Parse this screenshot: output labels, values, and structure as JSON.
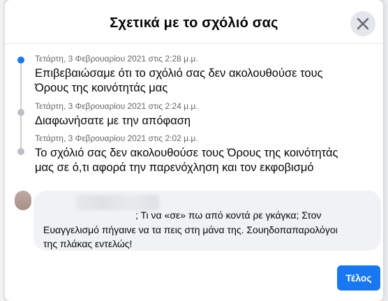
{
  "dialog": {
    "title": "Σχετικά με το σχόλιό σας",
    "close_icon": "close-icon",
    "done_label": "Τέλος",
    "accent_color": "#1877f2"
  },
  "timeline": [
    {
      "date": "Τετάρτη, 3 Φεβρουαρίου 2021 στις 2:28 μ.μ.",
      "lines": [
        "Επιβεβαιώσαμε ότι το σχόλιό σας δεν ακολουθούσε τους",
        "Όρους της κοινότητάς μας"
      ],
      "active": true
    },
    {
      "date": "Τετάρτη, 3 Φεβρουαρίου 2021 στις 2:24 μ.μ.",
      "lines": [
        "Διαφωνήσατε με την απόφαση"
      ],
      "active": false
    },
    {
      "date": "Τετάρτη, 3 Φεβρουαρίου 2021 στις 2:02 μ.μ.",
      "lines": [
        "Το σχόλιό σας δεν ακολουθούσε τους Όρους της κοινότητάς",
        "μας σε ό,τι αφορά την παρενόχληση και τον εκφοβισμό"
      ],
      "active": false
    }
  ],
  "comment": {
    "lines": [
      "; Τι να «σε» πω από κοντά ρε γκάγκα; Στον",
      "Ευαγγελισμό πήγαινε να τα πεις στη μάνα της. Σουηδοπαπαρολόγοι",
      "της πλάκας εντελώς!"
    ]
  }
}
